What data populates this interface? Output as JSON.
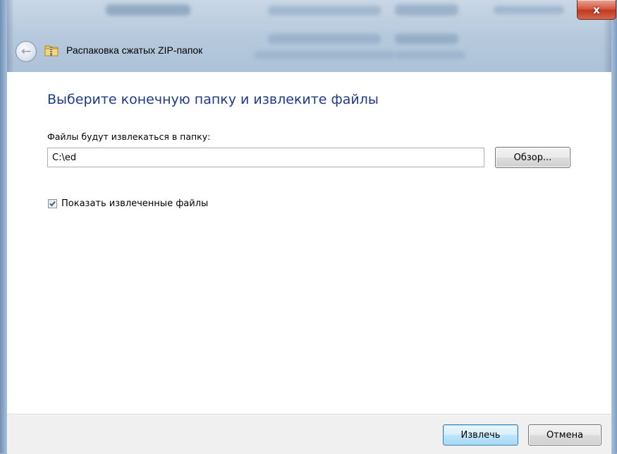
{
  "window": {
    "title": "Распаковка сжатых ZIP-папок",
    "close_label": "x"
  },
  "nav": {
    "back_icon": "back-arrow-icon",
    "title_icon": "zip-folder-icon"
  },
  "main": {
    "heading": "Выберите конечную папку и извлеките файлы",
    "destination_label": "Файлы будут извлекаться в папку:",
    "destination_value": "C:\\ed",
    "browse_label": "Обзор...",
    "show_files_checkbox": {
      "label": "Показать извлеченные файлы",
      "checked": true
    }
  },
  "footer": {
    "extract_label": "Извлечь",
    "cancel_label": "Отмена"
  },
  "colors": {
    "heading": "#1e3a8c",
    "close_button": "#c03a20",
    "default_button_border": "#3c7fb1",
    "footer_background": "#f0f0f0"
  }
}
